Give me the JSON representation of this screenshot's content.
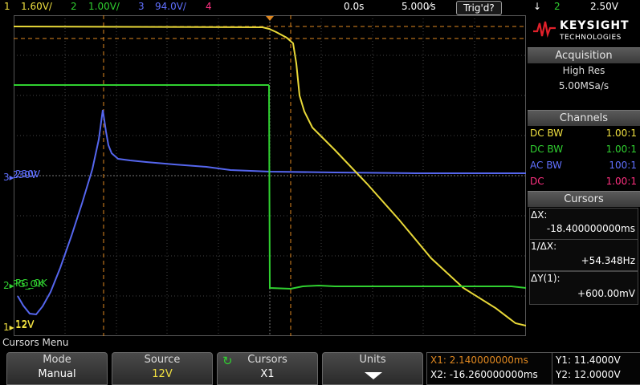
{
  "topbar": {
    "ch1_num": "1",
    "ch1_scale": "1.60V/",
    "ch2_num": "2",
    "ch2_scale": "1.00V/",
    "ch3_num": "3",
    "ch3_scale": "94.0V/",
    "ch4_num": "4",
    "time_offset": "0.0s",
    "timebase": "5.000⁄s",
    "trig_status": "Trig'd?",
    "trig_slope": "↓",
    "trig_source": "2",
    "trig_level": "2.50V"
  },
  "brand": {
    "name": "KEYSIGHT",
    "sub": "TECHNOLOGIES"
  },
  "acquisition": {
    "header": "Acquisition",
    "mode": "High Res",
    "rate": "5.00MSa/s"
  },
  "channels": {
    "header": "Channels",
    "rows": [
      {
        "coupling": "DC BW",
        "probe": "1.00:1",
        "color": "#f0e040"
      },
      {
        "coupling": "DC BW",
        "probe": "1.00:1",
        "color": "#30d030"
      },
      {
        "coupling": "AC BW",
        "probe": "100:1",
        "color": "#6070ff"
      },
      {
        "coupling": "DC",
        "probe": "1.00:1",
        "color": "#ff3080"
      }
    ]
  },
  "cursors": {
    "header": "Cursors",
    "dx_label": "ΔX:",
    "dx_value": "-18.400000000ms",
    "inv_dx_label": "1/ΔX:",
    "inv_dx_value": "+54.348Hz",
    "dy_label": "ΔY(1):",
    "dy_value": "+600.00mV"
  },
  "markers": {
    "ch3_label": "230V",
    "ch2_label": "PG_OK",
    "ch1_label": "12V"
  },
  "menu": {
    "title": "Cursors Menu",
    "softkeys": [
      {
        "l1": "Mode",
        "l2": "Manual"
      },
      {
        "l1": "Source",
        "l2": "12V"
      },
      {
        "l1": "Cursors",
        "l2": "X1"
      },
      {
        "l1": "Units",
        "l2": ""
      }
    ]
  },
  "readout": {
    "x1": "X1: 2.140000000ms",
    "x2": "X2: -16.260000000ms",
    "y1": "Y1: 11.4000V",
    "y2": "Y2: 12.0000V"
  },
  "colors": {
    "ch1": "#f0e040",
    "ch2": "#30d030",
    "ch3": "#6070ff",
    "ch4": "#ff3080",
    "cursor": "#e08820"
  }
}
